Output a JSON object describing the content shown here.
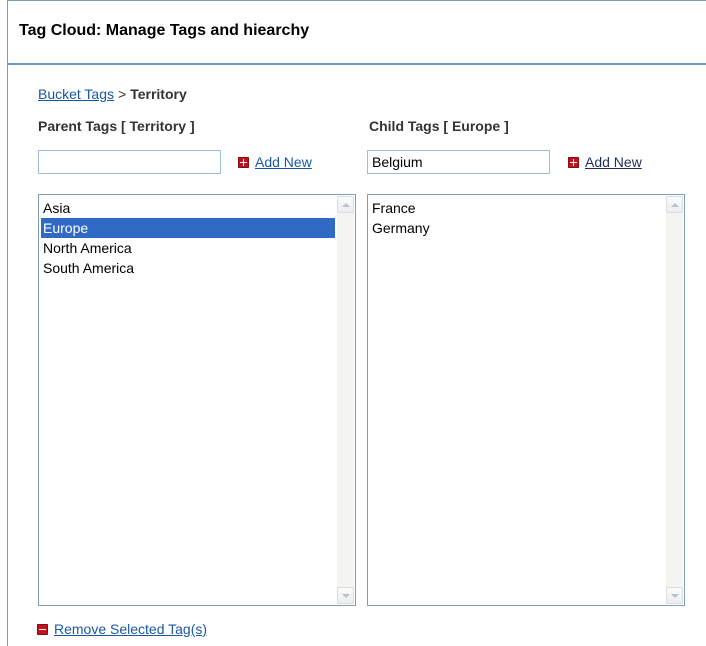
{
  "header": {
    "title": "Tag Cloud: Manage Tags and hiearchy"
  },
  "breadcrumb": {
    "link": "Bucket Tags",
    "separator": ">",
    "current": "Territory"
  },
  "parent": {
    "label": "Parent Tags [ Territory ]",
    "input_value": "",
    "add_label": "Add New",
    "items": [
      "Asia",
      "Europe",
      "North America",
      "South America"
    ],
    "selected": "Europe"
  },
  "child": {
    "label": "Child Tags [ Europe ]",
    "input_value": "Belgium",
    "add_label": "Add New",
    "items": [
      "France",
      "Germany"
    ]
  },
  "actions": {
    "remove_label": "Remove Selected Tag(s)"
  },
  "icons": {
    "add": "plus-icon",
    "remove": "minus-icon",
    "scroll_up": "arrow-up-icon",
    "scroll_down": "arrow-down-icon"
  },
  "colors": {
    "selection": "#316ac5",
    "link": "#1a57a6",
    "header_rule": "#6b9ad1",
    "icon_red": "#c1121f"
  }
}
